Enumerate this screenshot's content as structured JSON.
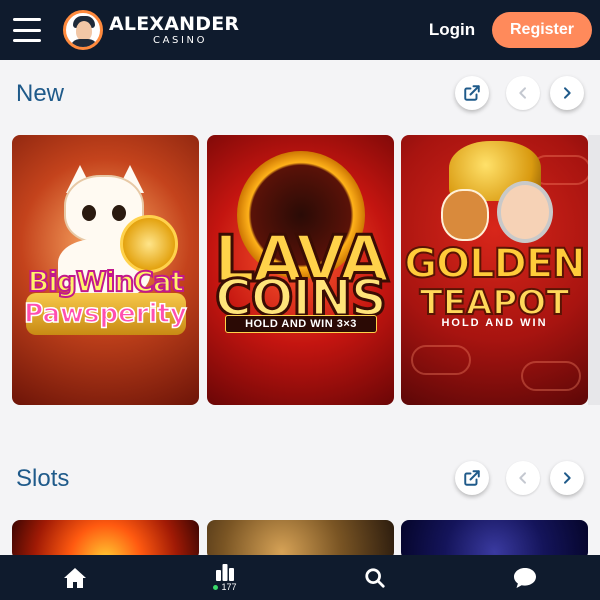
{
  "header": {
    "logo_name": "ALEXANDER",
    "logo_sub": "CASINO",
    "login_label": "Login",
    "register_label": "Register"
  },
  "sections": [
    {
      "title": "New",
      "games": [
        {
          "title_line1": "BigWinCat",
          "title_line2": "Pawsperity"
        },
        {
          "title_line1": "LAVA",
          "title_line2": "COINS",
          "tag": "HOLD AND WIN 3×3"
        },
        {
          "title_line1": "GOLDEN",
          "title_line2": "TEAPOT",
          "tag": "HOLD AND WIN"
        }
      ]
    },
    {
      "title": "Slots"
    }
  ],
  "bottom_nav": {
    "online_count": "177"
  },
  "colors": {
    "header_bg": "#0f1b2d",
    "accent": "#ff8a5b",
    "section_title": "#1f5a8a",
    "online_dot": "#3ad86a"
  },
  "icons": [
    "menu-icon",
    "external-link-icon",
    "chevron-left-icon",
    "chevron-right-icon",
    "home-icon",
    "leaderboard-icon",
    "search-icon",
    "chat-icon"
  ]
}
